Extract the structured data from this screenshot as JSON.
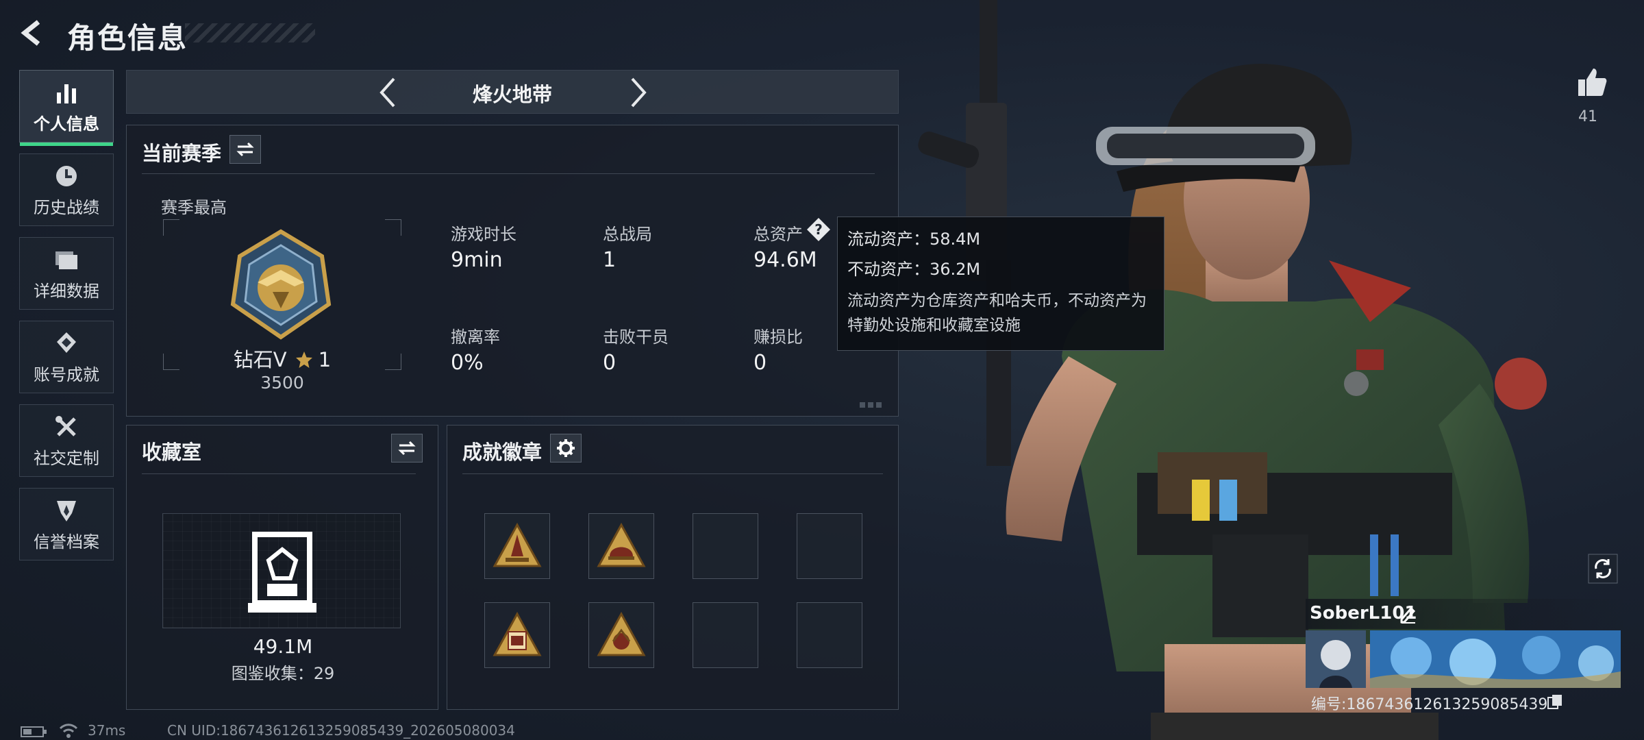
{
  "header": {
    "title": "角色信息"
  },
  "sidebar": {
    "items": [
      {
        "label": "个人信息",
        "icon": "bar-chart-icon",
        "active": true
      },
      {
        "label": "历史战绩",
        "icon": "clock-icon"
      },
      {
        "label": "详细数据",
        "icon": "folder-icon"
      },
      {
        "label": "账号成就",
        "icon": "achievement-icon"
      },
      {
        "label": "社交定制",
        "icon": "tools-icon"
      },
      {
        "label": "信誉档案",
        "icon": "shield-icon"
      }
    ]
  },
  "mode": {
    "title": "烽火地带"
  },
  "season": {
    "title": "当前赛季",
    "best_label": "赛季最高",
    "rank_name": "钻石V",
    "rank_star": "1",
    "rank_points": "3500",
    "stats": [
      {
        "label": "游戏时长",
        "value": "9min"
      },
      {
        "label": "总战局",
        "value": "1"
      },
      {
        "label": "总资产",
        "value": "94.6M"
      },
      {
        "label": "撤离率",
        "value": "0%"
      },
      {
        "label": "击败干员",
        "value": "0"
      },
      {
        "label": "赚损比",
        "value": "0"
      }
    ]
  },
  "tooltip": {
    "liquid": "流动资产：58.4M",
    "fixed": "不动资产：36.2M",
    "desc": "流动资产为仓库资产和哈夫币，不动资产为特勤处设施和收藏室设施"
  },
  "collection": {
    "title": "收藏室",
    "value": "49.1M",
    "count": "图鉴收集：29"
  },
  "badges": {
    "title": "成就徽章",
    "slots": [
      {
        "filled": true,
        "icon": "badge-rocket-icon"
      },
      {
        "filled": true,
        "icon": "badge-helmet-icon"
      },
      {
        "filled": false
      },
      {
        "filled": false
      },
      {
        "filled": true,
        "icon": "badge-58-icon"
      },
      {
        "filled": true,
        "icon": "badge-emblem-icon"
      },
      {
        "filled": false
      },
      {
        "filled": false
      }
    ]
  },
  "profile": {
    "likes": "41",
    "name": "SoberL101",
    "id_text": "编号:18674361261325908543​9"
  },
  "status": {
    "ping": "37ms",
    "uid": "CN UID:18674361261325908543​9_202605080034"
  },
  "colors": {
    "accent": "#3fd58a",
    "gold": "#c9a04a"
  }
}
